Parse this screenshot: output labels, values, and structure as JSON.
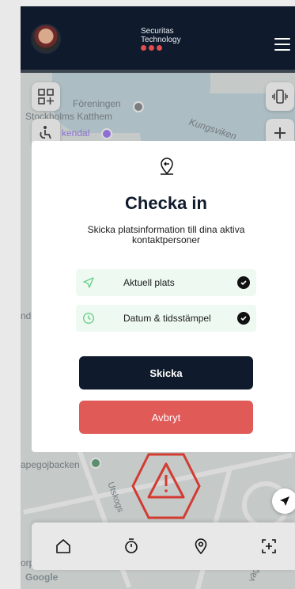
{
  "header": {
    "brand_line1": "Securitas",
    "brand_line2": "Technology"
  },
  "map": {
    "labels": {
      "foreningen": "Föreningen",
      "katthem": "Stockholms Katthem",
      "kendal": "kendal",
      "kungsviken": "Kungsviken",
      "nd": "nd",
      "papegojbacken": "apegojbacken",
      "utskogs": "Utskogs",
      "orp": "orp",
      "vag": "väg",
      "google": "Google"
    }
  },
  "modal": {
    "title": "Checka in",
    "description": "Skicka platsinformation till dina aktiva kontaktpersoner",
    "rows": [
      {
        "label": "Aktuell plats",
        "icon": "location-arrow-icon"
      },
      {
        "label": "Datum & tidsstämpel",
        "icon": "clock-icon"
      }
    ],
    "primary_button": "Skicka",
    "cancel_button": "Avbryt"
  },
  "colors": {
    "header_bg": "#0f1b2c",
    "accent_red": "#e05a58",
    "row_bg": "#eefaf1",
    "icon_green": "#6bcf8a"
  }
}
